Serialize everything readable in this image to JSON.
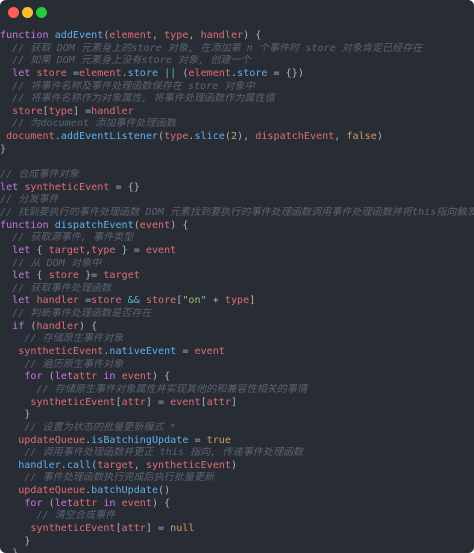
{
  "window": {
    "controls": [
      "close",
      "minimize",
      "maximize"
    ],
    "colors": {
      "close": "#ff5f56",
      "minimize": "#ffbd2e",
      "maximize": "#27c93f",
      "background": "#282c34"
    }
  },
  "code": {
    "lines": [
      [
        [
          "kw",
          "function "
        ],
        [
          "fn",
          "addEvent"
        ],
        [
          "p",
          "("
        ],
        [
          "var",
          "element"
        ],
        [
          "p",
          ", "
        ],
        [
          "var",
          "type"
        ],
        [
          "p",
          ", "
        ],
        [
          "var",
          "handler"
        ],
        [
          "p",
          ") {"
        ]
      ],
      [
        [
          "sp",
          "  "
        ],
        [
          "cm",
          "// 获取 DOM 元素身上的store 对象, 在添加第 n 个事件时 store 对象肯定已经存在"
        ]
      ],
      [
        [
          "sp",
          "  "
        ],
        [
          "cm",
          "// 如果 DOM 元素身上没有store 对象, 创建一个"
        ]
      ],
      [
        [
          "sp",
          "  "
        ],
        [
          "kw",
          "let "
        ],
        [
          "var",
          "store"
        ],
        [
          "p",
          " ="
        ],
        [
          "var",
          "element"
        ],
        [
          "p",
          "."
        ],
        [
          "prop",
          "store"
        ],
        [
          "p",
          " "
        ],
        [
          "op",
          "||"
        ],
        [
          "p",
          " ("
        ],
        [
          "var",
          "element"
        ],
        [
          "p",
          "."
        ],
        [
          "prop",
          "store"
        ],
        [
          "p",
          " = {})"
        ]
      ],
      [
        [
          "sp",
          "  "
        ],
        [
          "cm",
          "// 将事件名称及事件处理函数保存在 store 对象中"
        ]
      ],
      [
        [
          "sp",
          "  "
        ],
        [
          "cm",
          "// 将事件名称作为对象属性, 将事件处理函数作为属性值"
        ]
      ],
      [
        [
          "sp",
          "  "
        ],
        [
          "var",
          "store"
        ],
        [
          "p",
          "["
        ],
        [
          "var",
          "type"
        ],
        [
          "p",
          "] ="
        ],
        [
          "var",
          "handler"
        ]
      ],
      [
        [
          "sp",
          "  "
        ],
        [
          "cm",
          "// 为document 添加事件处理函数"
        ]
      ],
      [
        [
          "sp",
          " "
        ],
        [
          "var",
          "document"
        ],
        [
          "p",
          "."
        ],
        [
          "fn",
          "addEventListener"
        ],
        [
          "p",
          "("
        ],
        [
          "var",
          "type"
        ],
        [
          "p",
          "."
        ],
        [
          "fn",
          "slice"
        ],
        [
          "p",
          "("
        ],
        [
          "num",
          "2"
        ],
        [
          "p",
          "), "
        ],
        [
          "var",
          "dispatchEvent"
        ],
        [
          "p",
          ", "
        ],
        [
          "bool",
          "false"
        ],
        [
          "p",
          ")"
        ]
      ],
      [
        [
          "p",
          "}"
        ]
      ],
      [
        [
          "p",
          ""
        ]
      ],
      [
        [
          "cm",
          "// 合成事件对象"
        ]
      ],
      [
        [
          "kw",
          "let "
        ],
        [
          "var",
          "syntheticEvent"
        ],
        [
          "p",
          " = {}"
        ]
      ],
      [
        [
          "cm",
          "// 分发事件"
        ]
      ],
      [
        [
          "cm",
          "// 找到要执行的事件处理函数 DOM 元素找到要执行的事件处理函数调用事件处理函数并将this指向触发事件的元素"
        ]
      ],
      [
        [
          "kw",
          "function "
        ],
        [
          "fn",
          "dispatchEvent"
        ],
        [
          "p",
          "("
        ],
        [
          "var",
          "event"
        ],
        [
          "p",
          ") {"
        ]
      ],
      [
        [
          "sp",
          "  "
        ],
        [
          "cm",
          "// 获取源事件, 事件类型"
        ]
      ],
      [
        [
          "sp",
          "  "
        ],
        [
          "kw",
          "let "
        ],
        [
          "p",
          "{ "
        ],
        [
          "var",
          "target"
        ],
        [
          "p",
          ","
        ],
        [
          "var",
          "type"
        ],
        [
          "p",
          " } = "
        ],
        [
          "var",
          "event"
        ]
      ],
      [
        [
          "sp",
          "  "
        ],
        [
          "cm",
          "// 从 DOM 对象中"
        ]
      ],
      [
        [
          "sp",
          "  "
        ],
        [
          "kw",
          "let "
        ],
        [
          "p",
          "{ "
        ],
        [
          "var",
          "store"
        ],
        [
          "p",
          " }= "
        ],
        [
          "var",
          "target"
        ]
      ],
      [
        [
          "sp",
          "  "
        ],
        [
          "cm",
          "// 获取事件处理函数"
        ]
      ],
      [
        [
          "sp",
          "  "
        ],
        [
          "kw",
          "let "
        ],
        [
          "var",
          "handler"
        ],
        [
          "p",
          " ="
        ],
        [
          "var",
          "store"
        ],
        [
          "p",
          " "
        ],
        [
          "op",
          "&&"
        ],
        [
          "p",
          " "
        ],
        [
          "var",
          "store"
        ],
        [
          "p",
          "["
        ],
        [
          "str",
          "\"on\""
        ],
        [
          "p",
          " + "
        ],
        [
          "var",
          "type"
        ],
        [
          "p",
          "]"
        ]
      ],
      [
        [
          "sp",
          "  "
        ],
        [
          "cm",
          "// 判断事件处理函数是否存在"
        ]
      ],
      [
        [
          "sp",
          "  "
        ],
        [
          "kw",
          "if "
        ],
        [
          "p",
          "("
        ],
        [
          "var",
          "handler"
        ],
        [
          "p",
          ") {"
        ]
      ],
      [
        [
          "sp",
          "    "
        ],
        [
          "cm",
          "// 存储原生事件对象"
        ]
      ],
      [
        [
          "sp",
          "   "
        ],
        [
          "var",
          "syntheticEvent"
        ],
        [
          "p",
          "."
        ],
        [
          "prop",
          "nativeEvent"
        ],
        [
          "p",
          " = "
        ],
        [
          "var",
          "event"
        ]
      ],
      [
        [
          "sp",
          "    "
        ],
        [
          "cm",
          "// 遍历原生事件对象"
        ]
      ],
      [
        [
          "sp",
          "    "
        ],
        [
          "kw",
          "for "
        ],
        [
          "p",
          "("
        ],
        [
          "kw",
          "let"
        ],
        [
          "var",
          "attr"
        ],
        [
          "p",
          " "
        ],
        [
          "kw",
          "in "
        ],
        [
          "var",
          "event"
        ],
        [
          "p",
          ") {"
        ]
      ],
      [
        [
          "sp",
          "      "
        ],
        [
          "cm",
          "// 存储原生事件对象属性并实现其他的和兼容性相关的事情"
        ]
      ],
      [
        [
          "sp",
          "     "
        ],
        [
          "var",
          "syntheticEvent"
        ],
        [
          "p",
          "["
        ],
        [
          "var",
          "attr"
        ],
        [
          "p",
          "] = "
        ],
        [
          "var",
          "event"
        ],
        [
          "p",
          "["
        ],
        [
          "var",
          "attr"
        ],
        [
          "p",
          "]"
        ]
      ],
      [
        [
          "sp",
          "    "
        ],
        [
          "p",
          "}"
        ]
      ],
      [
        [
          "sp",
          "    "
        ],
        [
          "cm",
          "// 设置为状态的批量更新模式 *"
        ]
      ],
      [
        [
          "sp",
          "   "
        ],
        [
          "var",
          "updateQueue"
        ],
        [
          "p",
          "."
        ],
        [
          "prop",
          "isBatchingUpdate"
        ],
        [
          "p",
          " = "
        ],
        [
          "bool",
          "true"
        ]
      ],
      [
        [
          "sp",
          "    "
        ],
        [
          "cm",
          "// 调用事件处理函数并更正 this 指向, 传递事件处理函数"
        ]
      ],
      [
        [
          "sp",
          "   "
        ],
        [
          "fn",
          "handler"
        ],
        [
          "p",
          "."
        ],
        [
          "fn",
          "call"
        ],
        [
          "p",
          "("
        ],
        [
          "var",
          "target"
        ],
        [
          "p",
          ", "
        ],
        [
          "var",
          "syntheticEvent"
        ],
        [
          "p",
          ")"
        ]
      ],
      [
        [
          "sp",
          "    "
        ],
        [
          "cm",
          "// 事件处理函数执行完成后执行批量更新"
        ]
      ],
      [
        [
          "sp",
          "   "
        ],
        [
          "var",
          "updateQueue"
        ],
        [
          "p",
          "."
        ],
        [
          "fn",
          "batchUpdate"
        ],
        [
          "p",
          "()"
        ]
      ],
      [
        [
          "sp",
          "    "
        ],
        [
          "kw",
          "for "
        ],
        [
          "p",
          "("
        ],
        [
          "kw",
          "let"
        ],
        [
          "var",
          "attr"
        ],
        [
          "p",
          " "
        ],
        [
          "kw",
          "in "
        ],
        [
          "var",
          "event"
        ],
        [
          "p",
          ") {"
        ]
      ],
      [
        [
          "sp",
          "      "
        ],
        [
          "cm",
          "// 清空合成事件"
        ]
      ],
      [
        [
          "sp",
          "     "
        ],
        [
          "var",
          "syntheticEvent"
        ],
        [
          "p",
          "["
        ],
        [
          "var",
          "attr"
        ],
        [
          "p",
          "] = "
        ],
        [
          "bool",
          "null"
        ]
      ],
      [
        [
          "sp",
          "    "
        ],
        [
          "p",
          "}"
        ]
      ],
      [
        [
          "sp",
          "  "
        ],
        [
          "p",
          "}"
        ]
      ],
      [
        [
          "p",
          "}"
        ]
      ]
    ]
  }
}
